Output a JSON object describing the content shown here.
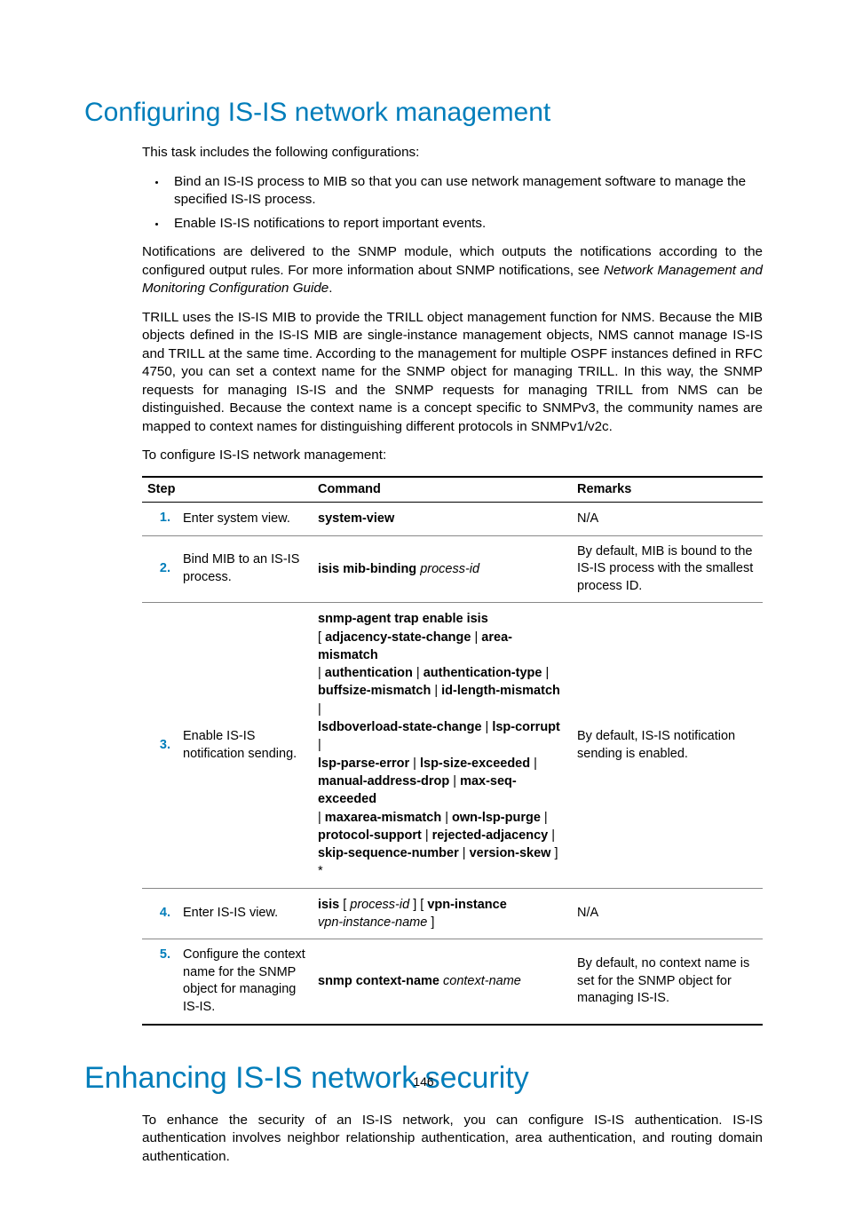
{
  "section1": {
    "title": "Configuring IS-IS network management",
    "intro": "This task includes the following configurations:",
    "bullets": [
      "Bind an IS-IS process to MIB so that you can use network management software to manage the specified IS-IS process.",
      "Enable IS-IS notifications to report important events."
    ],
    "para_notif_a": "Notifications are delivered to the SNMP module, which outputs the notifications according to the configured output rules. For more information about SNMP notifications, see ",
    "para_notif_ref": "Network Management and Monitoring Configuration Guide",
    "para_notif_b": ".",
    "para_trill": "TRILL uses the IS-IS MIB to provide the TRILL object management function for NMS. Because the MIB objects defined in the IS-IS MIB are single-instance management objects, NMS cannot manage IS-IS and TRILL at the same time. According to the management for multiple OSPF instances defined in RFC 4750, you can set a context name for the SNMP object for managing TRILL. In this way, the SNMP requests for managing IS-IS and the SNMP requests for managing TRILL from NMS can be distinguished. Because the context name is a concept specific to SNMPv3, the community names are mapped to context names for distinguishing different protocols in SNMPv1/v2c.",
    "para_toconfig": "To configure IS-IS network management:"
  },
  "table": {
    "headers": {
      "step": "Step",
      "command": "Command",
      "remarks": "Remarks"
    },
    "rows": [
      {
        "num": "1.",
        "step": "Enter system view.",
        "cmd_bold": "system-view",
        "remarks": "N/A"
      },
      {
        "num": "2.",
        "step": "Bind MIB to an IS-IS process.",
        "cmd_bold": "isis mib-binding",
        "cmd_italic": " process-id",
        "remarks": "By default, MIB is bound to the IS-IS process with the smallest process ID."
      },
      {
        "num": "3.",
        "step": "Enable IS-IS notification sending.",
        "cmd3_l1": "snmp-agent trap enable isis",
        "cmd3_l2a": "[ ",
        "cmd3_l2b": "adjacency-state-change",
        "cmd3_l2c": " | ",
        "cmd3_l2d": "area-mismatch",
        "cmd3_l3a": " | ",
        "cmd3_l3b": "authentication",
        "cmd3_l3c": " | ",
        "cmd3_l3d": "authentication-type",
        "cmd3_l3e": " |",
        "cmd3_l4a": "buffsize-mismatch",
        "cmd3_l4b": " | ",
        "cmd3_l4c": "id-length-mismatch",
        "cmd3_l4d": " |",
        "cmd3_l5a": "lsdboverload-state-change",
        "cmd3_l5b": " | ",
        "cmd3_l5c": "lsp-corrupt",
        "cmd3_l5d": " |",
        "cmd3_l6a": "lsp-parse-error",
        "cmd3_l6b": " | ",
        "cmd3_l6c": "lsp-size-exceeded",
        "cmd3_l6d": " |",
        "cmd3_l7a": "manual-address-drop",
        "cmd3_l7b": " | ",
        "cmd3_l7c": "max-seq-exceeded",
        "cmd3_l8a": " | ",
        "cmd3_l8b": "maxarea-mismatch",
        "cmd3_l8c": " | ",
        "cmd3_l8d": "own-lsp-purge",
        "cmd3_l8e": " |",
        "cmd3_l9a": "protocol-support",
        "cmd3_l9b": "  | ",
        "cmd3_l9c": "rejected-adjacency",
        "cmd3_l9d": " |",
        "cmd3_l10a": "skip-sequence-number",
        "cmd3_l10b": " | ",
        "cmd3_l10c": "version-skew",
        "cmd3_l10d": " ] *",
        "remarks": "By default, IS-IS notification sending is enabled."
      },
      {
        "num": "4.",
        "step": "Enter IS-IS view.",
        "cmd4_a": "isis",
        "cmd4_b": " [ ",
        "cmd4_c": "process-id",
        "cmd4_d": " ] [ ",
        "cmd4_e": "vpn-instance",
        "cmd4_f": "vpn-instance-name",
        "cmd4_g": " ]",
        "remarks": "N/A"
      },
      {
        "num": "5.",
        "step": "Configure the context name for the SNMP object for managing IS-IS.",
        "cmd_bold": "snmp context-name",
        "cmd_italic": " context-name",
        "remarks": "By default, no context name is set for the SNMP object for managing IS-IS."
      }
    ]
  },
  "section2": {
    "title": "Enhancing IS-IS network security",
    "para": "To enhance the security of an IS-IS network, you can configure IS-IS authentication. IS-IS authentication involves neighbor relationship authentication, area authentication, and routing domain authentication."
  },
  "page_number": "146"
}
